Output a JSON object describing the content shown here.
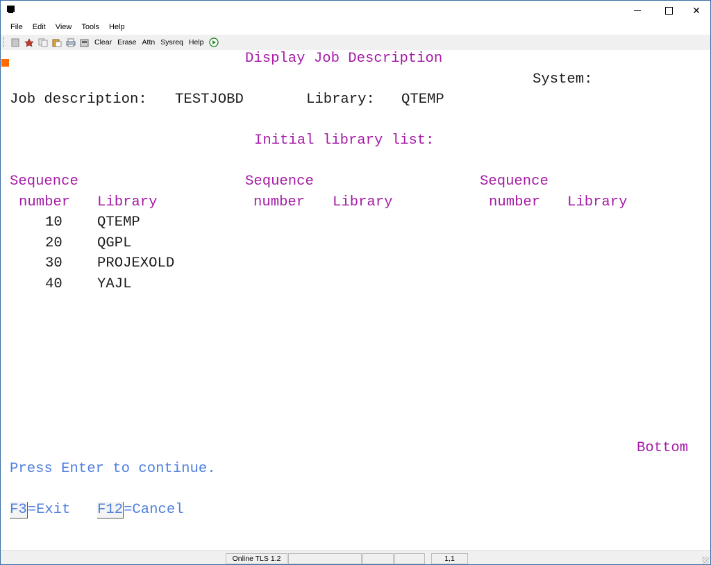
{
  "window": {
    "title": "",
    "controls": {
      "minimize_icon": "minimize-icon",
      "maximize_icon": "maximize-icon",
      "close_glyph": "✕"
    }
  },
  "menu": [
    "File",
    "Edit",
    "View",
    "Tools",
    "Help"
  ],
  "toolbar": {
    "icons": [
      "new-session-icon",
      "macro-icon",
      "copy-icon",
      "paste-icon",
      "print-icon",
      "settings-icon"
    ],
    "buttons": [
      "Clear",
      "Erase",
      "Attn",
      "Sysreq",
      "Help"
    ],
    "play_icon": "play-icon"
  },
  "screen": {
    "title": "Display Job Description",
    "system_label": "System:",
    "job_description_label": "Job description:",
    "job_description_value": "TESTJOBD",
    "library_label": "Library:",
    "library_value": "QTEMP",
    "initial_library_list": "Initial library list:",
    "col_sequence": "Sequence",
    "col_number": "number",
    "col_library": "Library",
    "rows": [
      {
        "seq": "10",
        "lib": "QTEMP"
      },
      {
        "seq": "20",
        "lib": "QGPL"
      },
      {
        "seq": "30",
        "lib": "PROJEXOLD"
      },
      {
        "seq": "40",
        "lib": "YAJL"
      }
    ],
    "bottom": "Bottom",
    "prompt": "Press Enter to continue.",
    "f3_key": "F3",
    "f3_text": "=Exit",
    "f12_key": "F12",
    "f12_text": "=Cancel"
  },
  "colors": {
    "field_label": "#a51aa5",
    "info_text": "#4f7fdf",
    "cursor": "#ff6a00"
  },
  "status": {
    "connection": "Online TLS 1.2",
    "cursor_pos": "1,1"
  }
}
